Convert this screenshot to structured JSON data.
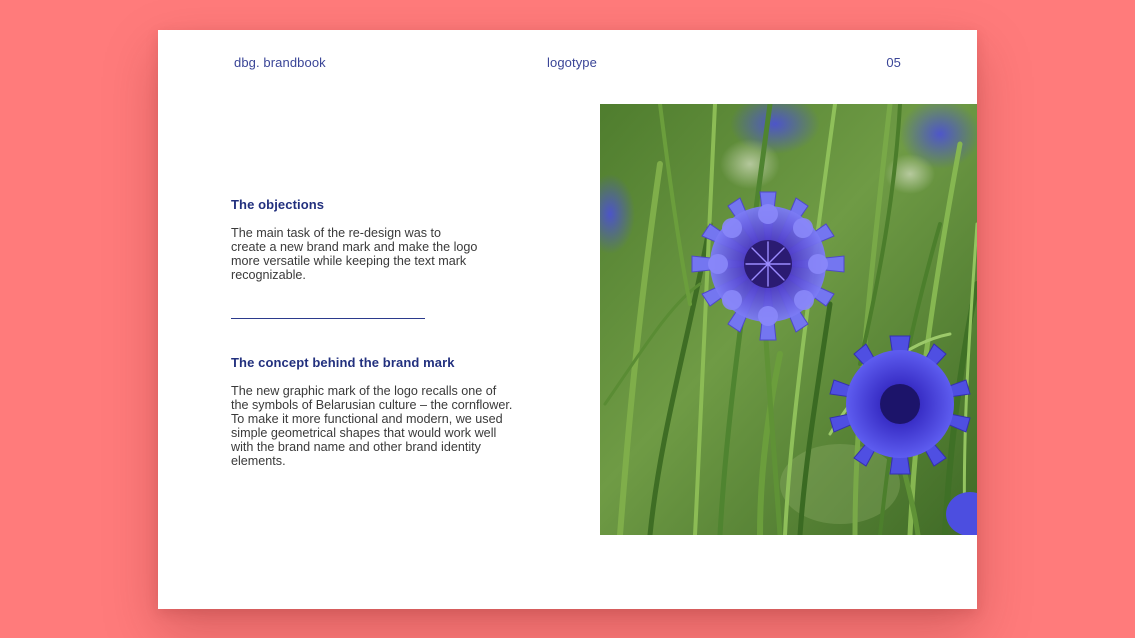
{
  "header": {
    "left": "dbg. brandbook",
    "center": "logotype",
    "page_number": "05"
  },
  "sections": [
    {
      "heading": "The objections",
      "body": "The main task of the re-design was to create a new brand mark and make the logo more versatile while keeping the text mark recognizable."
    },
    {
      "heading": "The concept behind the brand mark",
      "body": "The new graphic mark of the logo recalls one of the symbols of Belarusian culture – the cornflower. To make it more functional and modern, we used simple geometrical shapes that would work well with the brand name and other brand identity elements."
    }
  ],
  "colors": {
    "background": "#ff7b7b",
    "page": "#ffffff",
    "accent": "#22307e",
    "flower": "#5b4fe0"
  }
}
